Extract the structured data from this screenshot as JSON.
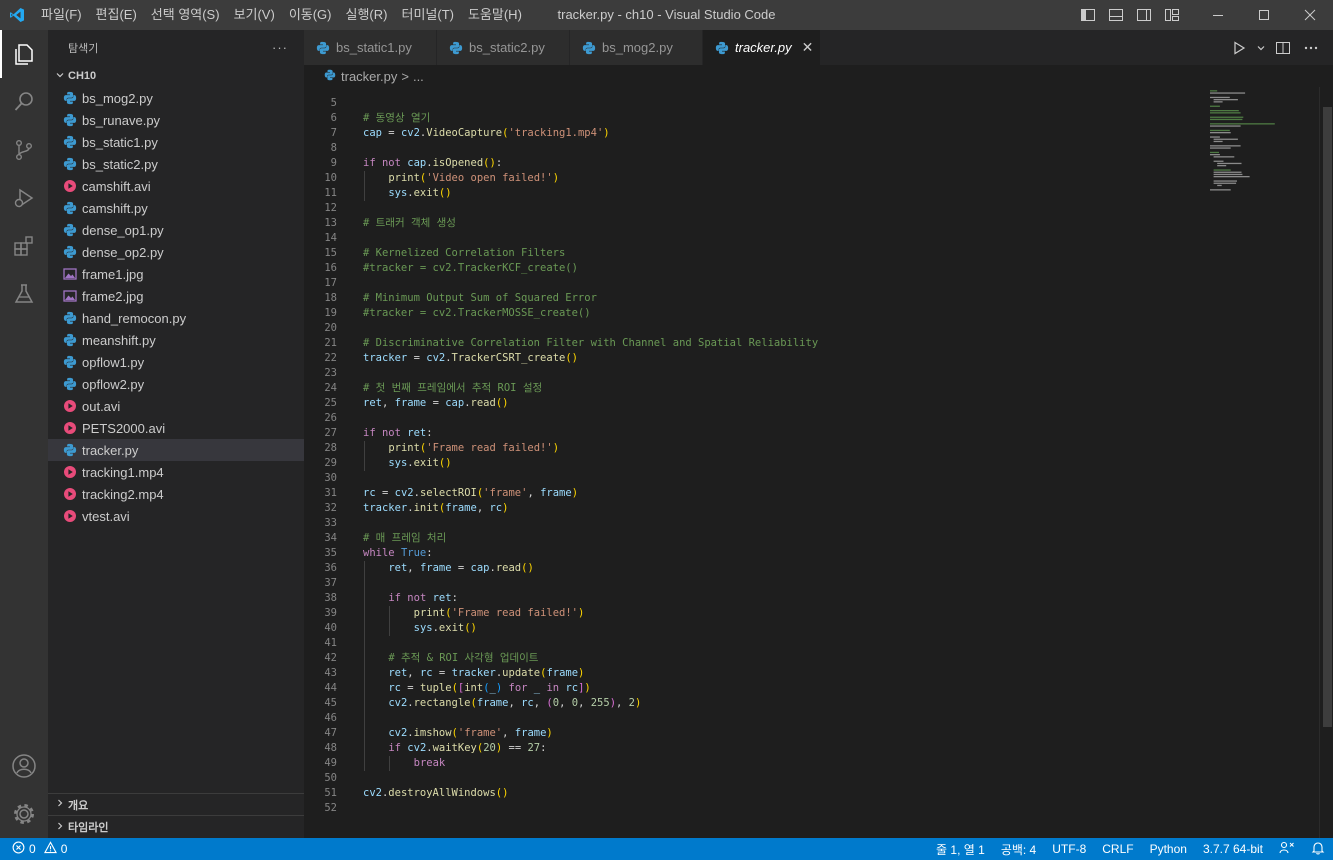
{
  "window": {
    "title": "tracker.py - ch10 - Visual Studio Code",
    "menu": [
      "파일(F)",
      "편집(E)",
      "선택 영역(S)",
      "보기(V)",
      "이동(G)",
      "실행(R)",
      "터미널(T)",
      "도움말(H)"
    ]
  },
  "activity_bar": {
    "items": [
      "explorer-icon",
      "search-icon",
      "source-control-icon",
      "run-debug-icon",
      "extensions-icon",
      "testing-icon"
    ],
    "bottom": [
      "account-icon",
      "settings-gear-icon"
    ]
  },
  "sidebar": {
    "title": "탐색기",
    "more": "···",
    "folder": "CH10",
    "files": [
      {
        "name": "bs_mog2.py",
        "type": "py"
      },
      {
        "name": "bs_runave.py",
        "type": "py"
      },
      {
        "name": "bs_static1.py",
        "type": "py"
      },
      {
        "name": "bs_static2.py",
        "type": "py"
      },
      {
        "name": "camshift.avi",
        "type": "avi"
      },
      {
        "name": "camshift.py",
        "type": "py"
      },
      {
        "name": "dense_op1.py",
        "type": "py"
      },
      {
        "name": "dense_op2.py",
        "type": "py"
      },
      {
        "name": "frame1.jpg",
        "type": "jpg"
      },
      {
        "name": "frame2.jpg",
        "type": "jpg"
      },
      {
        "name": "hand_remocon.py",
        "type": "py"
      },
      {
        "name": "meanshift.py",
        "type": "py"
      },
      {
        "name": "opflow1.py",
        "type": "py"
      },
      {
        "name": "opflow2.py",
        "type": "py"
      },
      {
        "name": "out.avi",
        "type": "avi"
      },
      {
        "name": "PETS2000.avi",
        "type": "avi"
      },
      {
        "name": "tracker.py",
        "type": "py",
        "selected": true
      },
      {
        "name": "tracking1.mp4",
        "type": "avi"
      },
      {
        "name": "tracking2.mp4",
        "type": "avi"
      },
      {
        "name": "vtest.avi",
        "type": "avi"
      }
    ],
    "outline": "개요",
    "timeline": "타임라인"
  },
  "tabs": [
    {
      "label": "bs_static1.py",
      "active": false
    },
    {
      "label": "bs_static2.py",
      "active": false
    },
    {
      "label": "bs_mog2.py",
      "active": false
    },
    {
      "label": "tracker.py",
      "active": true
    }
  ],
  "breadcrumbs": {
    "file": "tracker.py",
    "sep": ">",
    "rest": "..."
  },
  "code": {
    "first_line": 5,
    "lines": [
      "",
      "# 동영상 열기",
      "cap = cv2.VideoCapture('tracking1.mp4')",
      "",
      "if not cap.isOpened():",
      "    print('Video open failed!')",
      "    sys.exit()",
      "",
      "# 트래커 객체 생성",
      "",
      "# Kernelized Correlation Filters",
      "#tracker = cv2.TrackerKCF_create()",
      "",
      "# Minimum Output Sum of Squared Error",
      "#tracker = cv2.TrackerMOSSE_create()",
      "",
      "# Discriminative Correlation Filter with Channel and Spatial Reliability",
      "tracker = cv2.TrackerCSRT_create()",
      "",
      "# 첫 번째 프레임에서 추적 ROI 설정",
      "ret, frame = cap.read()",
      "",
      "if not ret:",
      "    print('Frame read failed!')",
      "    sys.exit()",
      "",
      "rc = cv2.selectROI('frame', frame)",
      "tracker.init(frame, rc)",
      "",
      "# 매 프레임 처리",
      "while True:",
      "    ret, frame = cap.read()",
      "",
      "    if not ret:",
      "        print('Frame read failed!')",
      "        sys.exit()",
      "",
      "    # 추적 & ROI 사각형 업데이트",
      "    ret, rc = tracker.update(frame)",
      "    rc = tuple([int(_) for _ in rc])",
      "    cv2.rectangle(frame, rc, (0, 0, 255), 2)",
      "",
      "    cv2.imshow('frame', frame)",
      "    if cv2.waitKey(20) == 27:",
      "        break",
      "",
      "cv2.destroyAllWindows()",
      ""
    ]
  },
  "statusbar": {
    "errors": "0",
    "warnings": "0",
    "position": "줄 1, 열 1",
    "spaces": "공백: 4",
    "encoding": "UTF-8",
    "eol": "CRLF",
    "language": "Python",
    "interpreter": "3.7.7 64-bit"
  },
  "colors": {
    "accent": "#007acc",
    "python_icon": "#3d9ad1",
    "media_icon": "#e84b7a",
    "image_icon": "#a074c4"
  }
}
